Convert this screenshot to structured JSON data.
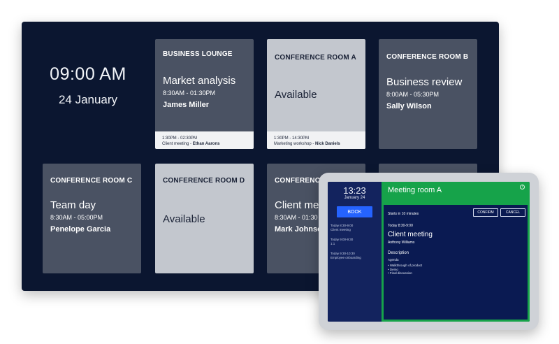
{
  "display": {
    "clock": {
      "time": "09:00 AM",
      "date": "24 January"
    },
    "rooms": [
      {
        "name": "BUSINESS LOUNGE",
        "title": "Market analysis",
        "time": "8:30AM - 01:30PM",
        "host": "James Miller",
        "next": {
          "time": "1:30PM - 02:30PM",
          "title": "Client meeting - ",
          "host": "Ethan Aarons"
        }
      },
      {
        "name": "CONFERENCE ROOM A",
        "status": "Available",
        "next": {
          "time": "1:30PM - 14:30PM",
          "title": "Marketing workshop - ",
          "host": "Nick Daniels"
        }
      },
      {
        "name": "CONFERENCE ROOM B",
        "title": "Business review",
        "time": "8:00AM - 05:30PM",
        "host": "Sally Wilson"
      },
      {
        "name": "CONFERENCE ROOM C",
        "title": "Team day",
        "time": "8:30AM - 05:00PM",
        "host": "Penelope Garcia"
      },
      {
        "name": "CONFERENCE ROOM D",
        "status": "Available"
      },
      {
        "name": "CONFERENCE",
        "title": "Client mee",
        "time": "8:30AM - 01:30",
        "host": "Mark Johnso"
      }
    ]
  },
  "tablet": {
    "time": "13:23",
    "date": "January 24",
    "book_label": "BOOK",
    "schedule": [
      {
        "time": "Today 8:30-9:00",
        "title": "Client meeting"
      },
      {
        "time": "Today 9:00-9:30",
        "title": "1:1"
      },
      {
        "time": "Today 9:30-10:30",
        "title": "Employee onboarding"
      }
    ],
    "room_name": "Meeting room A",
    "info_icon": "i",
    "starts_in": "Starts in 10 minutes",
    "confirm_label": "CONFIRM",
    "cancel_label": "CANCEL",
    "meeting_time": "Today 8:30-9:00",
    "meeting_title": "Client meeting",
    "meeting_host": "Anthony Williams",
    "description_heading": "Description",
    "agenda_label": "Agenda",
    "agenda_items": [
      "• Walkthrough of product",
      "• Demo",
      "• Final discussion"
    ]
  },
  "colors": {
    "display_bg": "#0b1630",
    "busy_tile": "#4a5263",
    "free_tile": "#c3c7ce",
    "tablet_accent": "#16a34a",
    "book_button": "#2563ff"
  }
}
